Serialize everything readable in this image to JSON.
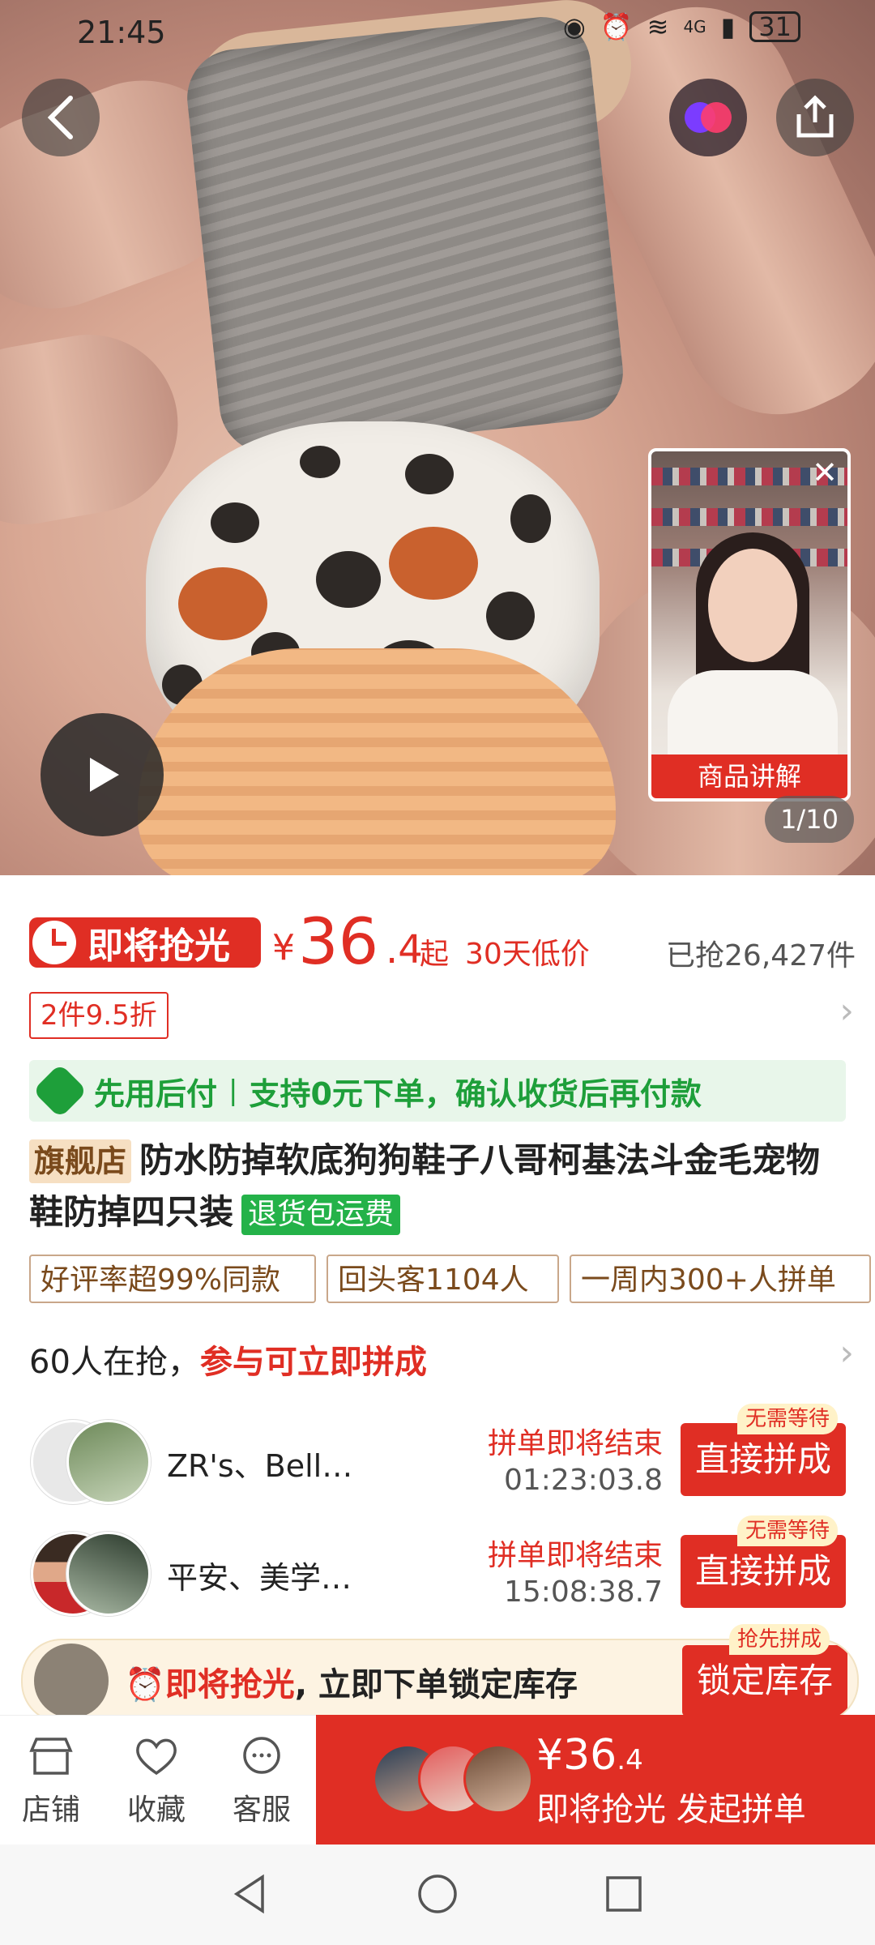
{
  "status_bar": {
    "time": "21:45",
    "network": "4G",
    "battery": "31"
  },
  "hero": {
    "page_indicator": "1/10",
    "video_label": "商品讲解"
  },
  "price": {
    "badge": "即将抢光",
    "symbol": "¥",
    "integer": "36",
    "decimal": ".4",
    "from": "起",
    "low_price_note": "30天低价",
    "sold": "已抢26,427件"
  },
  "discount_tag": "2件9.5折",
  "pay_later": {
    "title": "先用后付",
    "separator": "|",
    "desc": "支持0元下单，确认收货后再付款"
  },
  "product": {
    "flag": "旗舰店",
    "title": "防水防掉软底狗狗鞋子八哥柯基法斗金毛宠物鞋防掉四只装",
    "return_tag": "退货包运费"
  },
  "chips": [
    "好评率超99%同款",
    "回头客1104人",
    "一周内300+人拼单"
  ],
  "group": {
    "count_text": "60人在抢，",
    "call_to_action": "参与可立即拼成",
    "rows": [
      {
        "names": "ZR's、Bell…",
        "status": "拼单即将结束",
        "timer": "01:23:03.8",
        "button": "直接拼成",
        "tag": "无需等待"
      },
      {
        "names": "平安、美学…",
        "status": "拼单即将结束",
        "timer": "15:08:38.7",
        "button": "直接拼成",
        "tag": "无需等待"
      }
    ]
  },
  "lock_banner": {
    "highlight": "即将抢光",
    "text": ", 立即下单锁定库存",
    "button": "锁定库存",
    "tag": "抢先拼成"
  },
  "bottom_bar": {
    "tabs": [
      "店铺",
      "收藏",
      "客服"
    ],
    "buy_price_symbol": "¥",
    "buy_price_int": "36",
    "buy_price_dec": ".4",
    "buy_label": "即将抢光 发起拼单"
  },
  "colors": {
    "accent": "#e02e24",
    "green": "#1e9f3a",
    "tag_bg": "#f6dfc2"
  },
  "icons": [
    "back-icon",
    "live-icon",
    "share-icon",
    "play-icon",
    "close-icon",
    "chevron-right-icon",
    "store-icon",
    "heart-icon",
    "chat-icon",
    "clock-icon"
  ]
}
